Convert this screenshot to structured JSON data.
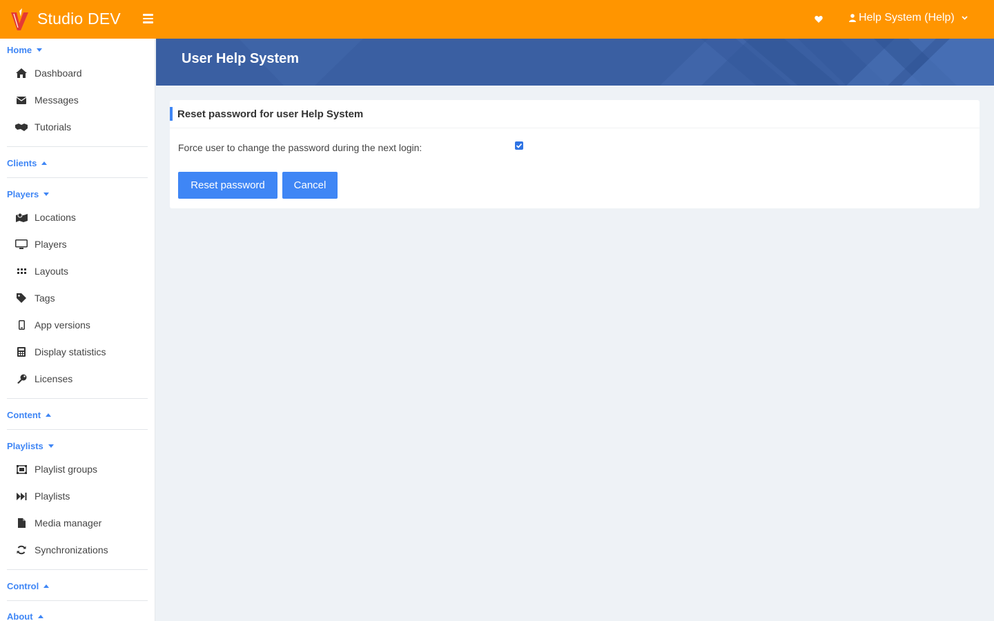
{
  "app": {
    "title": "Studio DEV",
    "accent": "#ff9500",
    "link_color": "#3f86f5"
  },
  "header": {
    "user_label": "Help System (Help)"
  },
  "sidebar": {
    "home": {
      "label": "Home",
      "items": [
        "Dashboard",
        "Messages",
        "Tutorials"
      ]
    },
    "clients": {
      "label": "Clients"
    },
    "players": {
      "label": "Players",
      "items": [
        "Locations",
        "Players",
        "Layouts",
        "Tags",
        "App versions",
        "Display statistics",
        "Licenses"
      ]
    },
    "content": {
      "label": "Content"
    },
    "playlists": {
      "label": "Playlists",
      "items": [
        "Playlist groups",
        "Playlists",
        "Media manager",
        "Synchronizations"
      ]
    },
    "control": {
      "label": "Control"
    },
    "about": {
      "label": "About"
    }
  },
  "banner": {
    "title": "User Help System"
  },
  "card": {
    "title": "Reset password for user Help System",
    "force_label": "Force user to change the password during the next login:",
    "force_checked": true,
    "reset_button": "Reset password",
    "cancel_button": "Cancel"
  },
  "icons": {
    "home": "home-icon",
    "messages": "envelope-icon",
    "tutorials": "handshake-icon",
    "locations": "map-icon",
    "players": "monitor-icon",
    "layouts": "grid-icon",
    "tags": "tag-icon",
    "app_versions": "mobile-icon",
    "display_statistics": "calculator-icon",
    "licenses": "key-icon",
    "playlist_groups": "object-group-icon",
    "playlists": "fast-forward-icon",
    "media_manager": "file-icon",
    "synchronizations": "sync-icon"
  }
}
